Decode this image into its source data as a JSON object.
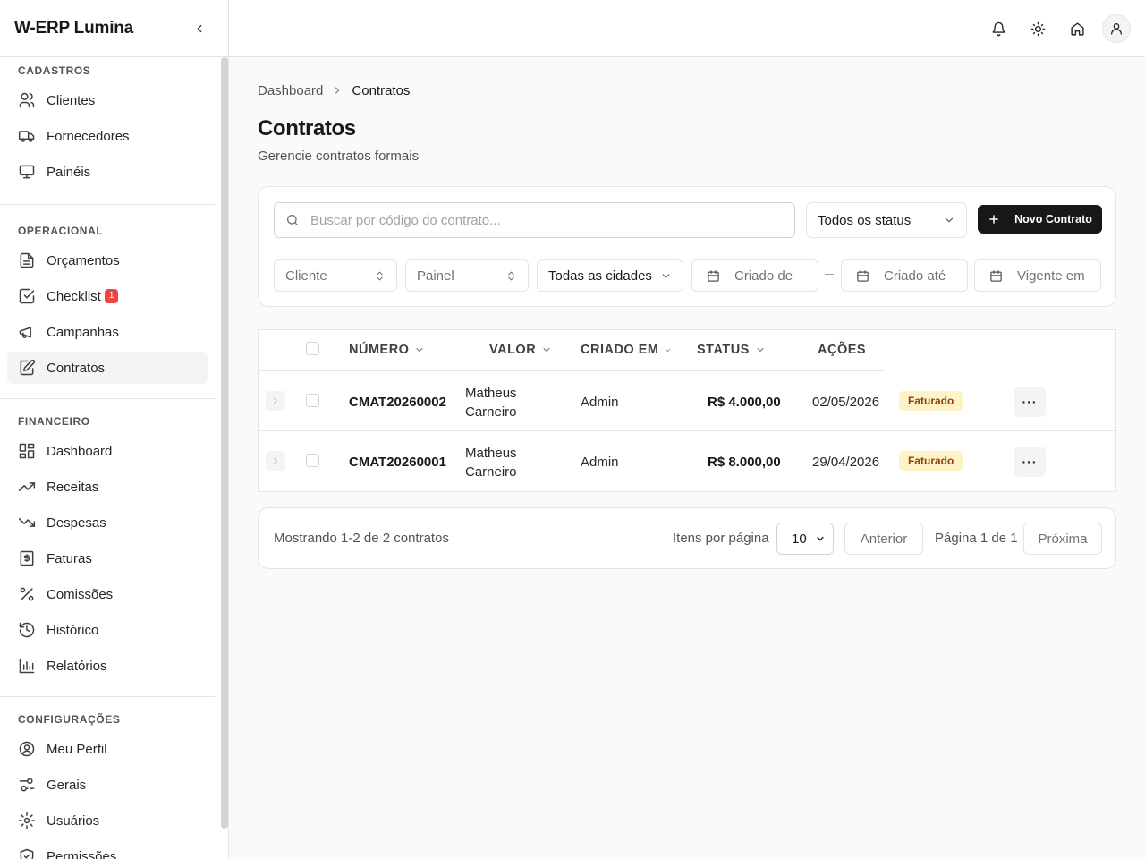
{
  "app": {
    "name": "W-ERP Lumina"
  },
  "sidebar": {
    "sections": [
      {
        "title": "CADASTROS",
        "items": [
          {
            "label": "Clientes",
            "icon": "users-icon"
          },
          {
            "label": "Fornecedores",
            "icon": "truck-icon"
          },
          {
            "label": "Painéis",
            "icon": "monitor-icon"
          }
        ]
      },
      {
        "title": "OPERACIONAL",
        "items": [
          {
            "label": "Orçamentos",
            "icon": "file-text-icon"
          },
          {
            "label": "Checklist",
            "icon": "check-square-icon",
            "badge": "1"
          },
          {
            "label": "Campanhas",
            "icon": "megaphone-icon"
          },
          {
            "label": "Contratos",
            "icon": "edit-file-icon",
            "active": true
          }
        ]
      },
      {
        "title": "FINANCEIRO",
        "items": [
          {
            "label": "Dashboard",
            "icon": "layout-dashboard-icon"
          },
          {
            "label": "Receitas",
            "icon": "trending-up-icon"
          },
          {
            "label": "Despesas",
            "icon": "trending-down-icon"
          },
          {
            "label": "Faturas",
            "icon": "receipt-icon"
          },
          {
            "label": "Comissões",
            "icon": "percent-icon"
          },
          {
            "label": "Histórico",
            "icon": "history-icon"
          },
          {
            "label": "Relatórios",
            "icon": "bar-chart-icon"
          }
        ]
      },
      {
        "title": "CONFIGURAÇÕES",
        "items": [
          {
            "label": "Meu Perfil",
            "icon": "user-circle-icon"
          },
          {
            "label": "Gerais",
            "icon": "sliders-icon"
          },
          {
            "label": "Usuários",
            "icon": "gear-icon"
          },
          {
            "label": "Permissões",
            "icon": "shield-icon"
          }
        ]
      }
    ]
  },
  "breadcrumb": {
    "parent": "Dashboard",
    "current": "Contratos"
  },
  "page": {
    "title": "Contratos",
    "subtitle": "Gerencie contratos formais"
  },
  "filters": {
    "search_placeholder": "Buscar por código do contrato...",
    "status": "Todos os status",
    "new_button": "Novo Contrato",
    "client": "Cliente",
    "panel": "Painel",
    "cities": "Todas as cidades",
    "created_from": "Criado de",
    "created_to": "Criado até",
    "valid_on": "Vigente em"
  },
  "table": {
    "headers": {
      "number": "NÚMERO",
      "value": "VALOR",
      "created_at": "CRIADO EM",
      "status": "STATUS",
      "actions": "AÇÕES"
    },
    "rows": [
      {
        "number": "CMAT20260002",
        "client_first": "Matheus",
        "client_last": "Carneiro",
        "creator": "Admin",
        "value": "R$ 4.000,00",
        "date": "02/05/2026",
        "status": "Faturado"
      },
      {
        "number": "CMAT20260001",
        "client_first": "Matheus",
        "client_last": "Carneiro",
        "creator": "Admin",
        "value": "R$ 8.000,00",
        "date": "29/04/2026",
        "status": "Faturado"
      }
    ]
  },
  "pagination": {
    "showing": "Mostrando 1-2 de 2 contratos",
    "per_page_label": "Itens por página",
    "per_page": "10",
    "prev": "Anterior",
    "page_info": "Página 1 de 1",
    "next": "Próxima"
  },
  "colors": {
    "primary": "#18181b",
    "badge_red": "#ef4444",
    "status_bg": "#fef3c7",
    "status_text": "#92400e"
  }
}
